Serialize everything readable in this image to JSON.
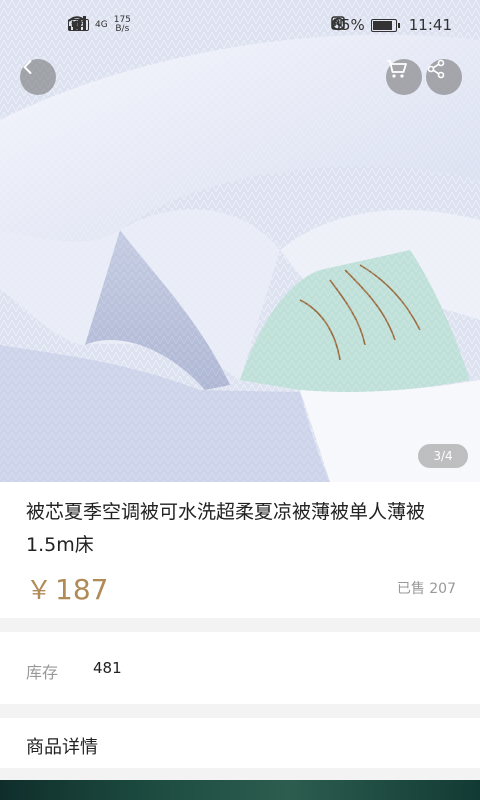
{
  "status_bar": {
    "speed_value": "175",
    "speed_unit": "B/s",
    "network": "4G",
    "hd": "HD",
    "battery_percent": "85%",
    "battery_level": 0.85,
    "time": "11:41"
  },
  "gallery": {
    "pager": "3/4"
  },
  "product": {
    "title": "被芯夏季空调被可水洗超柔夏凉被薄被单人薄被1.5m床",
    "currency": "￥",
    "price": "187",
    "sold": "已售 207"
  },
  "stock": {
    "label": "库存",
    "value": "481"
  },
  "detail": {
    "label": "商品详情"
  },
  "icons": {
    "back": "chevron-left-icon",
    "cart": "cart-icon",
    "share": "share-icon"
  },
  "colors": {
    "price": "#b08a57",
    "overlay_button": "#6e6e6e"
  }
}
